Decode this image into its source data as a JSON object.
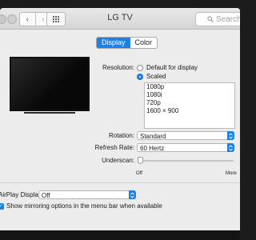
{
  "window": {
    "title": "LG TV"
  },
  "toolbar": {
    "search_placeholder": "Search",
    "back_glyph": "‹",
    "forward_glyph": "›"
  },
  "tabs": [
    {
      "label": "Display",
      "active": true
    },
    {
      "label": "Color",
      "active": false
    }
  ],
  "resolution": {
    "label": "Resolution:",
    "options": [
      {
        "label": "Default for display",
        "checked": false
      },
      {
        "label": "Scaled",
        "checked": true
      }
    ],
    "list": [
      "1080p",
      "1080i",
      "720p",
      "1600 × 900"
    ]
  },
  "rotation": {
    "label": "Rotation:",
    "value": "Standard"
  },
  "refresh_rate": {
    "label": "Refresh Rate:",
    "value": "60 Hertz"
  },
  "underscan": {
    "label": "Underscan:",
    "min_label": "Off",
    "max_label": "More",
    "value": 0
  },
  "airplay": {
    "label": "AirPlay Display:",
    "value": "Off"
  },
  "mirroring": {
    "label": "Show mirroring options in the menu bar when available",
    "checked": true
  },
  "colors": {
    "accent": "#1e7fe6",
    "window_bg": "#ececec"
  }
}
